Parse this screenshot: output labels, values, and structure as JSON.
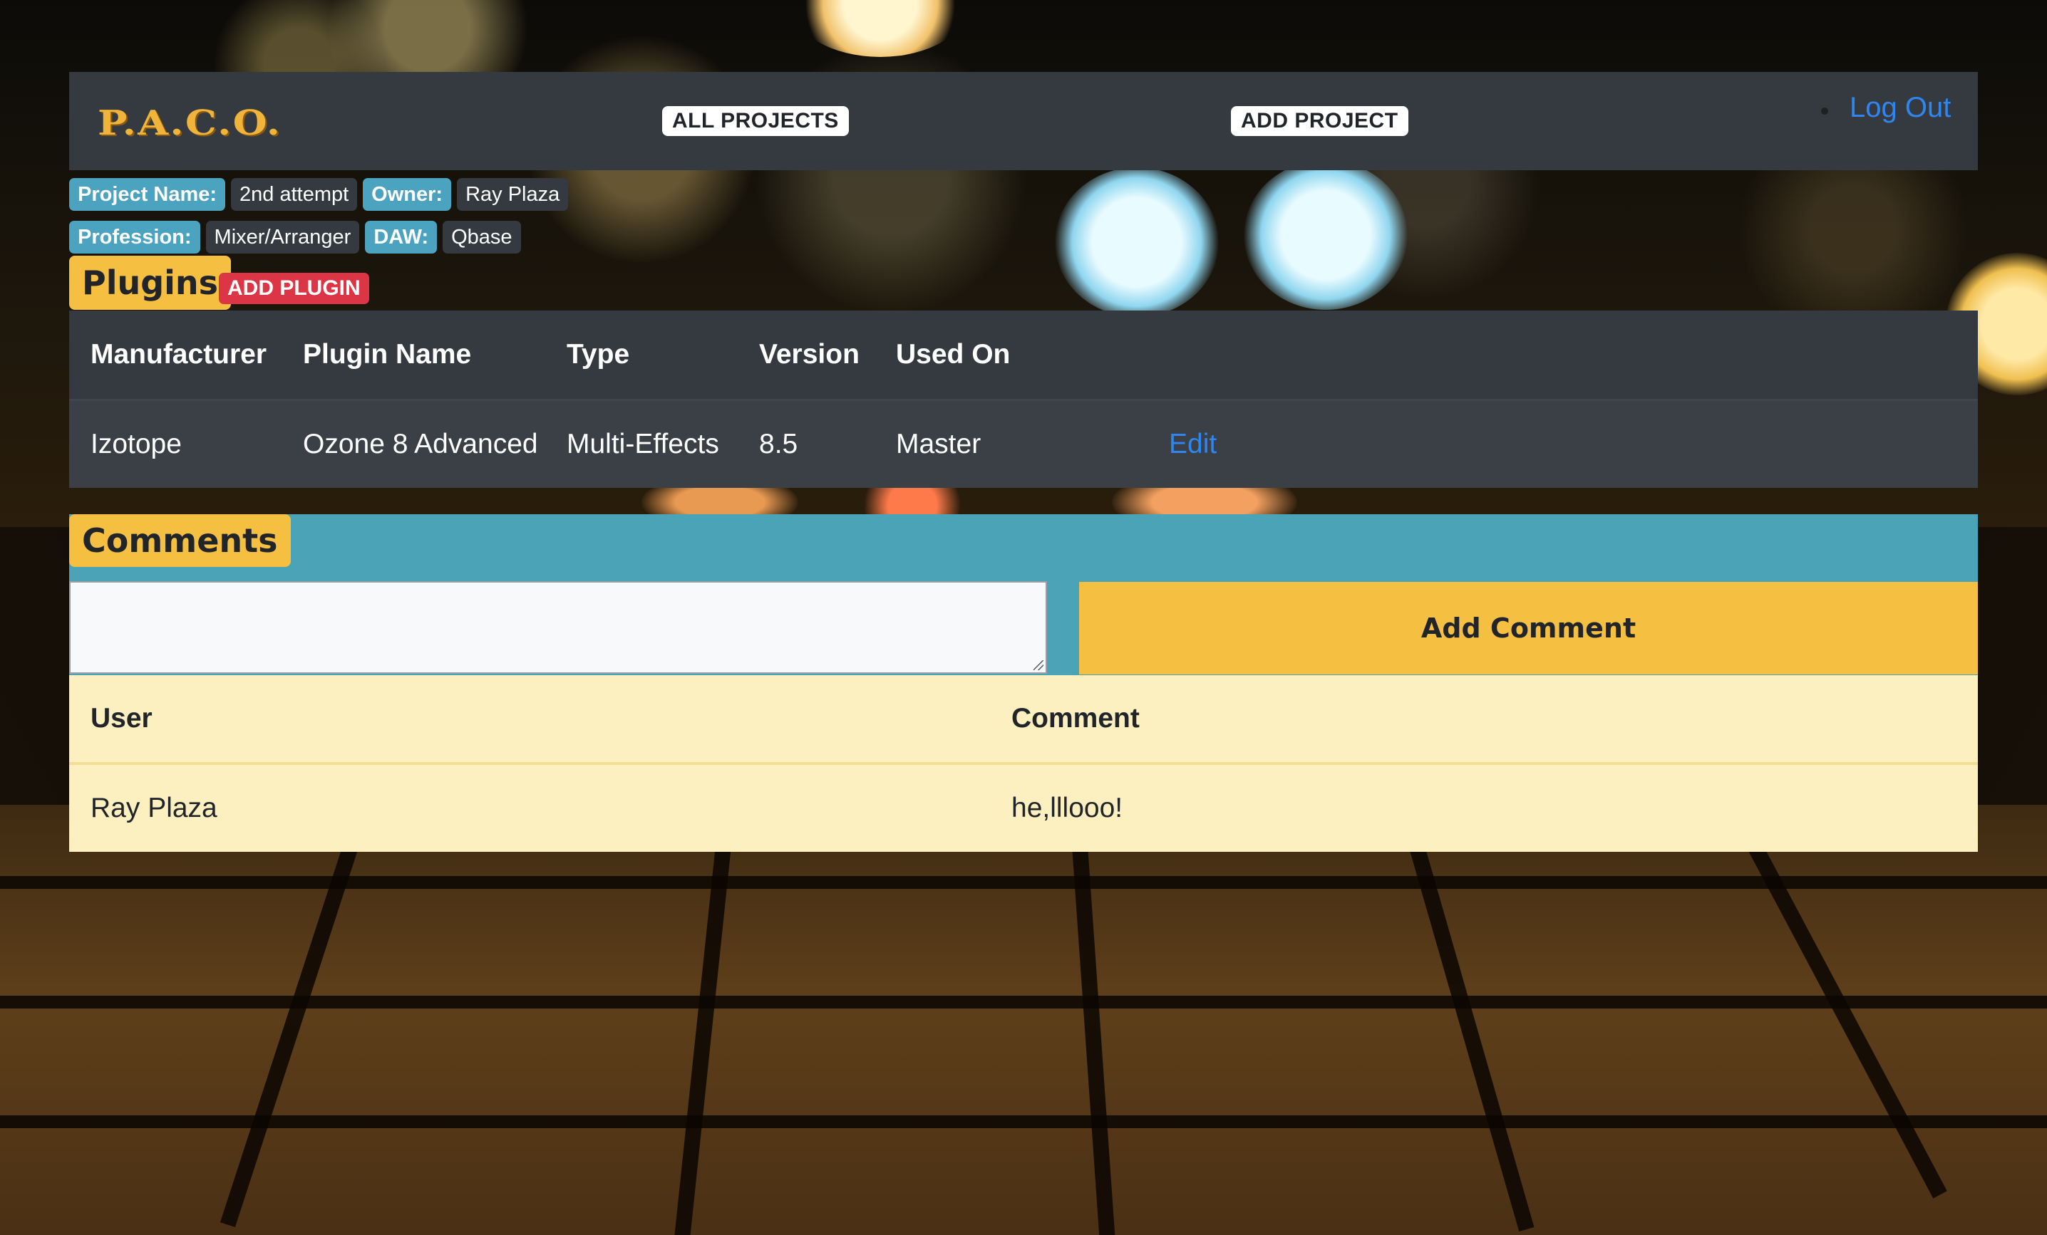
{
  "navbar": {
    "logo": "P.A.C.O.",
    "all_projects": "ALL PROJECTS",
    "add_project": "ADD PROJECT",
    "logout": "Log Out"
  },
  "project": {
    "name_label": "Project Name:",
    "name_value": "2nd attempt",
    "owner_label": "Owner:",
    "owner_value": "Ray Plaza",
    "profession_label": "Profession:",
    "profession_value": "Mixer/Arranger",
    "daw_label": "DAW:",
    "daw_value": "Qbase"
  },
  "plugins": {
    "title": "Plugins",
    "add_button": "ADD PLUGIN",
    "columns": [
      "Manufacturer",
      "Plugin Name",
      "Type",
      "Version",
      "Used On"
    ],
    "rows": [
      {
        "manufacturer": "Izotope",
        "plugin_name": "Ozone 8 Advanced",
        "type": "Multi-Effects",
        "version": "8.5",
        "used_on": "Master",
        "action": "Edit"
      }
    ]
  },
  "comments": {
    "title": "Comments",
    "input_value": "",
    "add_button": "Add Comment",
    "columns": [
      "User",
      "Comment"
    ],
    "rows": [
      {
        "user": "Ray Plaza",
        "comment": "he,lllooo!"
      }
    ]
  },
  "colors": {
    "navbar_bg": "#343a40",
    "info_label_bg": "#4ba3c0",
    "section_title_bg": "#f5c042",
    "danger": "#dc3545",
    "link": "#2f86f0",
    "comments_band": "#4ba3b8",
    "comments_table_bg": "#fcefc0"
  }
}
